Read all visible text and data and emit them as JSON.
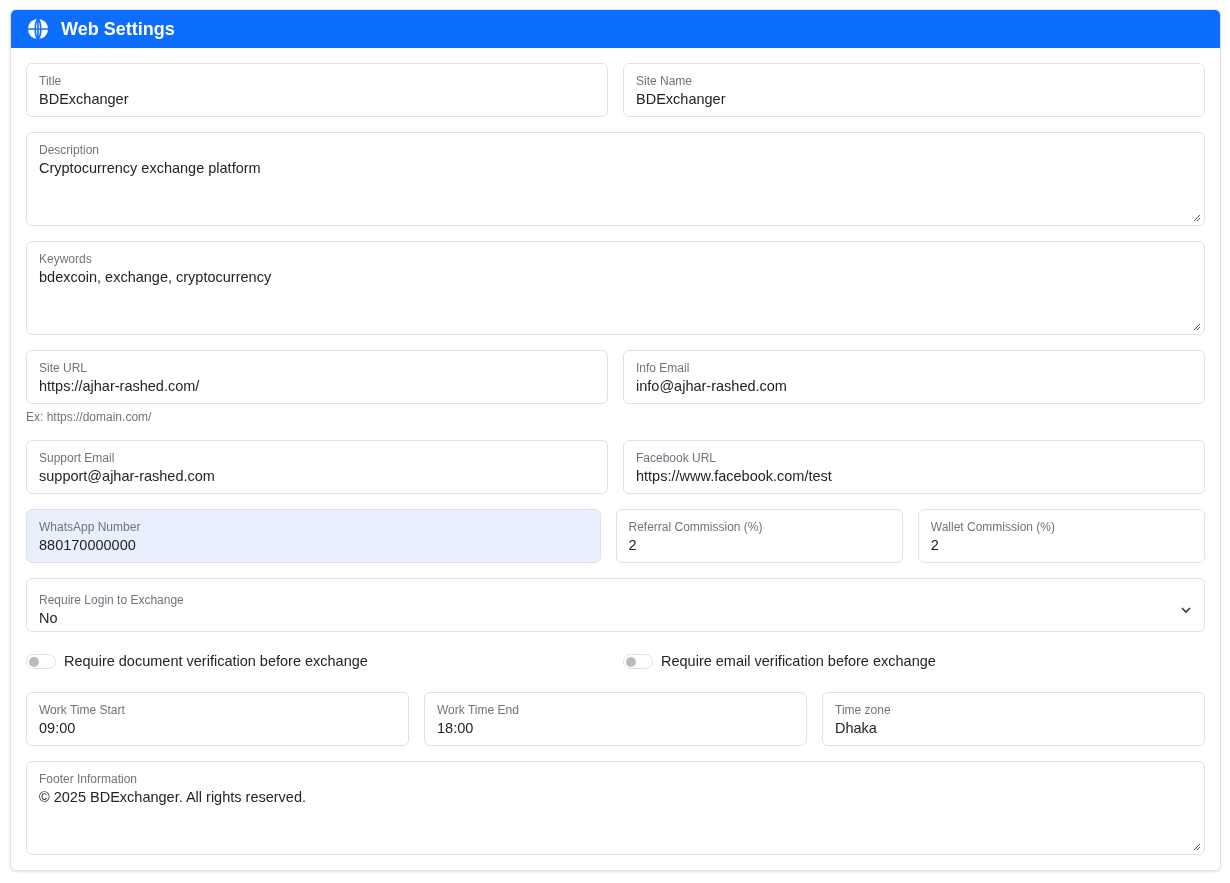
{
  "card": {
    "title": "Web Settings"
  },
  "rows": [
    {
      "kind": "fields",
      "fields": [
        {
          "kind": "input",
          "label": "Title",
          "value": "BDExchanger",
          "highlighted": false
        },
        {
          "kind": "input",
          "label": "Site Name",
          "value": "BDExchanger",
          "highlighted": false
        }
      ]
    },
    {
      "kind": "fields",
      "fields": [
        {
          "kind": "textarea",
          "label": "Description",
          "value": "Cryptocurrency exchange platform",
          "highlighted": false
        }
      ]
    },
    {
      "kind": "fields",
      "fields": [
        {
          "kind": "textarea",
          "label": "Keywords",
          "value": "bdexcoin, exchange, cryptocurrency",
          "highlighted": false
        }
      ]
    },
    {
      "kind": "fields",
      "fields": [
        {
          "kind": "input",
          "label": "Site URL",
          "value": "https://ajhar-rashed.com/",
          "help": "Ex: https://domain.com/",
          "highlighted": false
        },
        {
          "kind": "input",
          "label": "Info Email",
          "value": "info@ajhar-rashed.com",
          "highlighted": false
        }
      ]
    },
    {
      "kind": "fields",
      "fields": [
        {
          "kind": "input",
          "label": "Support Email",
          "value": "support@ajhar-rashed.com",
          "highlighted": false
        },
        {
          "kind": "input",
          "label": "Facebook URL",
          "value": "https://www.facebook.com/test",
          "highlighted": false
        }
      ]
    },
    {
      "kind": "half_and_quarters",
      "fields": [
        {
          "kind": "input",
          "label": "WhatsApp Number",
          "value": "880170000000",
          "highlighted": true
        },
        {
          "kind": "input",
          "label": "Referral Commission (%)",
          "value": "2",
          "highlighted": false
        },
        {
          "kind": "input",
          "label": "Wallet Commission (%)",
          "value": "2",
          "highlighted": false
        }
      ]
    },
    {
      "kind": "fields",
      "fields": [
        {
          "kind": "select",
          "label": "Require Login to Exchange",
          "value": "No",
          "highlighted": false
        }
      ]
    },
    {
      "kind": "toggles",
      "toggles": [
        {
          "label": "Require document verification before exchange",
          "on": false
        },
        {
          "label": "Require email verification before exchange",
          "on": false
        }
      ]
    },
    {
      "kind": "fields",
      "fields": [
        {
          "kind": "input",
          "label": "Work Time Start",
          "value": "09:00",
          "highlighted": false
        },
        {
          "kind": "input",
          "label": "Work Time End",
          "value": "18:00",
          "highlighted": false
        },
        {
          "kind": "input",
          "label": "Time zone",
          "value": "Dhaka",
          "highlighted": false
        }
      ]
    },
    {
      "kind": "fields",
      "fields": [
        {
          "kind": "textarea",
          "label": "Footer Information",
          "value": "© 2025 BDExchanger. All rights reserved.",
          "highlighted": false
        }
      ]
    }
  ]
}
